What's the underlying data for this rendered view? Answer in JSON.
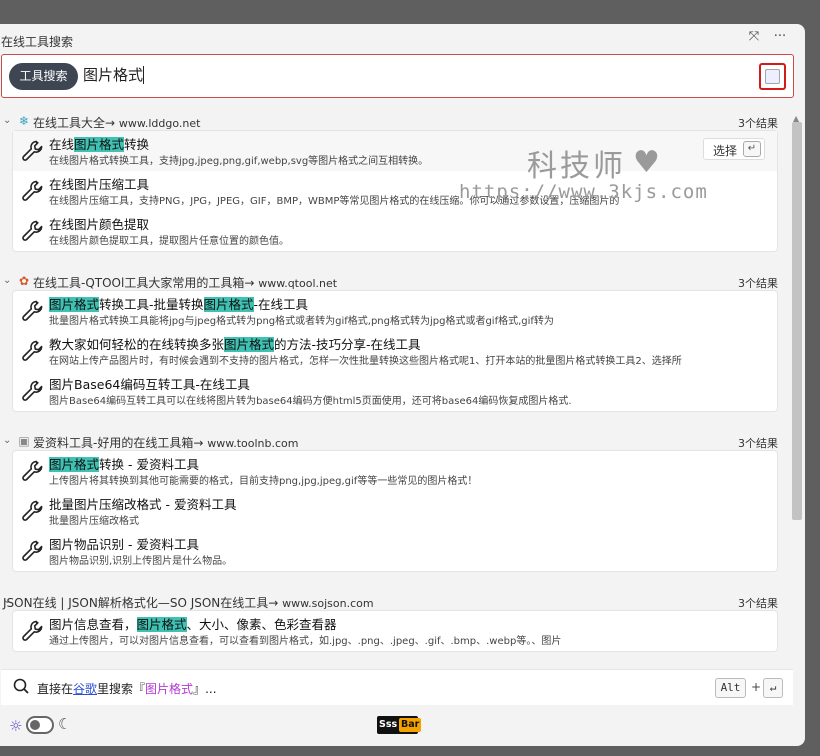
{
  "window": {
    "title": "在线工具搜索",
    "pin_icon": "pin-icon",
    "more_icon": "more-icon"
  },
  "search": {
    "mode_tag": "工具搜索",
    "query": "图片格式",
    "button_icon": "screenshot-search-icon"
  },
  "groups": [
    {
      "title": "在线工具大全→",
      "domain": "www.lddgo.net",
      "icon": "lddgo-logo-icon",
      "count": "3个结果",
      "items": [
        {
          "pre": "在线",
          "hl": "图片格式",
          "post": "转换",
          "desc": "在线图片格式转换工具，支持jpg,jpeg,png,gif,webp,svg等图片格式之间互相转换。"
        },
        {
          "pre": "在线图片压缩工具",
          "hl": "",
          "post": "",
          "desc": "在线图片压缩工具，支持PNG，JPG，JPEG，GIF，BMP，WBMP等常见图片格式的在线压缩。你可以通过参数设置，压缩图片的"
        },
        {
          "pre": "在线图片颜色提取",
          "hl": "",
          "post": "",
          "desc": "在线图片颜色提取工具，提取图片任意位置的颜色值。"
        }
      ]
    },
    {
      "title": "在线工具-QTOOl工具大家常用的工具箱→",
      "domain": "www.qtool.net",
      "icon": "qtool-logo-icon",
      "count": "3个结果",
      "items": [
        {
          "segments": [
            {
              "t": "图片格式",
              "h": true
            },
            {
              "t": "转换工具-批量转换",
              "h": false
            },
            {
              "t": "图片格式",
              "h": true
            },
            {
              "t": "-在线工具",
              "h": false
            }
          ],
          "desc": "批量图片格式转换工具能将jpg与jpeg格式转为png格式或者转为gif格式,png格式转为jpg格式或者gif格式,gif转为"
        },
        {
          "segments": [
            {
              "t": "教大家如何轻松的在线转换多张",
              "h": false
            },
            {
              "t": "图片格式",
              "h": true
            },
            {
              "t": "的方法-技巧分享-在线工具",
              "h": false
            }
          ],
          "desc": "在网站上传产品图片时，有时候会遇到不支持的图片格式，怎样一次性批量转换这些图片格式呢1、打开本站的批量图片格式转换工具2、选择所"
        },
        {
          "segments": [
            {
              "t": "图片Base64编码互转工具-在线工具",
              "h": false
            }
          ],
          "desc": "图片Base64编码互转工具可以在线将图片转为base64编码方便html5页面使用，还可将base64编码恢复成图片格式."
        }
      ]
    },
    {
      "title": "爱资料工具-好用的在线工具箱→",
      "domain": "www.toolnb.com",
      "icon": "toolnb-logo-icon",
      "count": "3个结果",
      "items": [
        {
          "segments": [
            {
              "t": "图片格式",
              "h": true
            },
            {
              "t": "转换 - 爱资料工具",
              "h": false
            }
          ],
          "desc": "上传图片将其转换到其他可能需要的格式，目前支持png,jpg,jpeg,gif等等一些常见的图片格式！"
        },
        {
          "segments": [
            {
              "t": "批量图片压缩改格式 - 爱资料工具",
              "h": false
            }
          ],
          "desc": "批量图片压缩改格式"
        },
        {
          "segments": [
            {
              "t": "图片物品识别 - 爱资料工具",
              "h": false
            }
          ],
          "desc": "图片物品识别,识别上传图片是什么物品。"
        }
      ]
    },
    {
      "title": "JSON在线 | JSON解析格式化—SO JSON在线工具→",
      "domain": "www.sojson.com",
      "icon": "",
      "count": "3个结果",
      "items": [
        {
          "segments": [
            {
              "t": "图片信息查看，",
              "h": false
            },
            {
              "t": "图片格式",
              "h": true
            },
            {
              "t": "、大小、像素、色彩查看器",
              "h": false
            }
          ],
          "desc": "通过上传图片，可以对图片信息查看，可以查看到图片格式，如.jpg、.png、.jpeg、.gif、.bmp、.webp等。、图片"
        }
      ]
    }
  ],
  "select_button": {
    "label": "选择",
    "enter_glyph": "↵"
  },
  "watermark": {
    "line1": "科技师",
    "heart": "♥",
    "line2": "https://www.3kjs.com"
  },
  "footer": {
    "prefix": "直接在",
    "engine": "谷歌",
    "middle": "里搜索『",
    "keyword": "图片格式",
    "suffix": "』...",
    "key1": "Alt",
    "plus": "+",
    "key2": "↵"
  },
  "bottom": {
    "sun_glyph": "☼",
    "moon_glyph": "☾",
    "brand_left": "Sss",
    "brand_right": "Bar"
  },
  "glyphs": {
    "chevron": "⌄",
    "pin": "⤧",
    "more": "···"
  },
  "colors": {
    "highlight": "#3fc1b3",
    "accent_red": "#d21b1b",
    "tag_bg": "#3e4653"
  }
}
